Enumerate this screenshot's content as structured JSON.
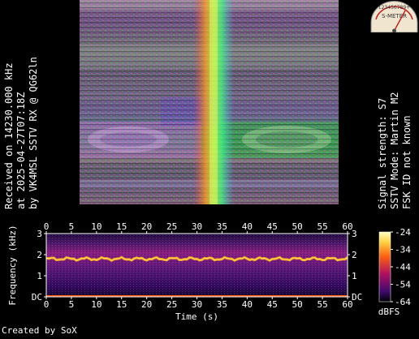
{
  "received_text": "Received on  14230.000 kHz",
  "timestamp_text": "at 2025-04-27T07:18Z",
  "receiver_text": "by VK4MSL SSTV RX @ QG62ln",
  "signal_strength_text": "Signal strength: S7",
  "sstv_mode_text": "SSTV Mode: Martin M2",
  "fsk_id_text": "FSK ID not known",
  "meter": {
    "scale_label": "S-METER",
    "scale_digits": "123456789+",
    "reading": "S7"
  },
  "credit_text": "Created by SoX",
  "chart_data": {
    "type": "heatmap",
    "title": "",
    "xlabel": "Time (s)",
    "ylabel": "Frequency (kHz)",
    "x_ticks": [
      "0",
      "5",
      "10",
      "15",
      "20",
      "25",
      "30",
      "35",
      "40",
      "45",
      "50",
      "55",
      "60"
    ],
    "y_ticks": [
      "DC",
      "1",
      "2",
      "3"
    ],
    "xlim": [
      0,
      60
    ],
    "ylim": [
      0,
      3
    ],
    "colorbar": {
      "label": "dBFS",
      "ticks": [
        "-24",
        "-34",
        "-44",
        "-54",
        "-64"
      ],
      "range": [
        -64,
        -24
      ]
    },
    "dominant_trace_khz": 1.8,
    "colors": {
      "low": "#000000",
      "mid": "#7a1a8a",
      "high": "#ff6a00",
      "peak": "#ffff80"
    }
  }
}
